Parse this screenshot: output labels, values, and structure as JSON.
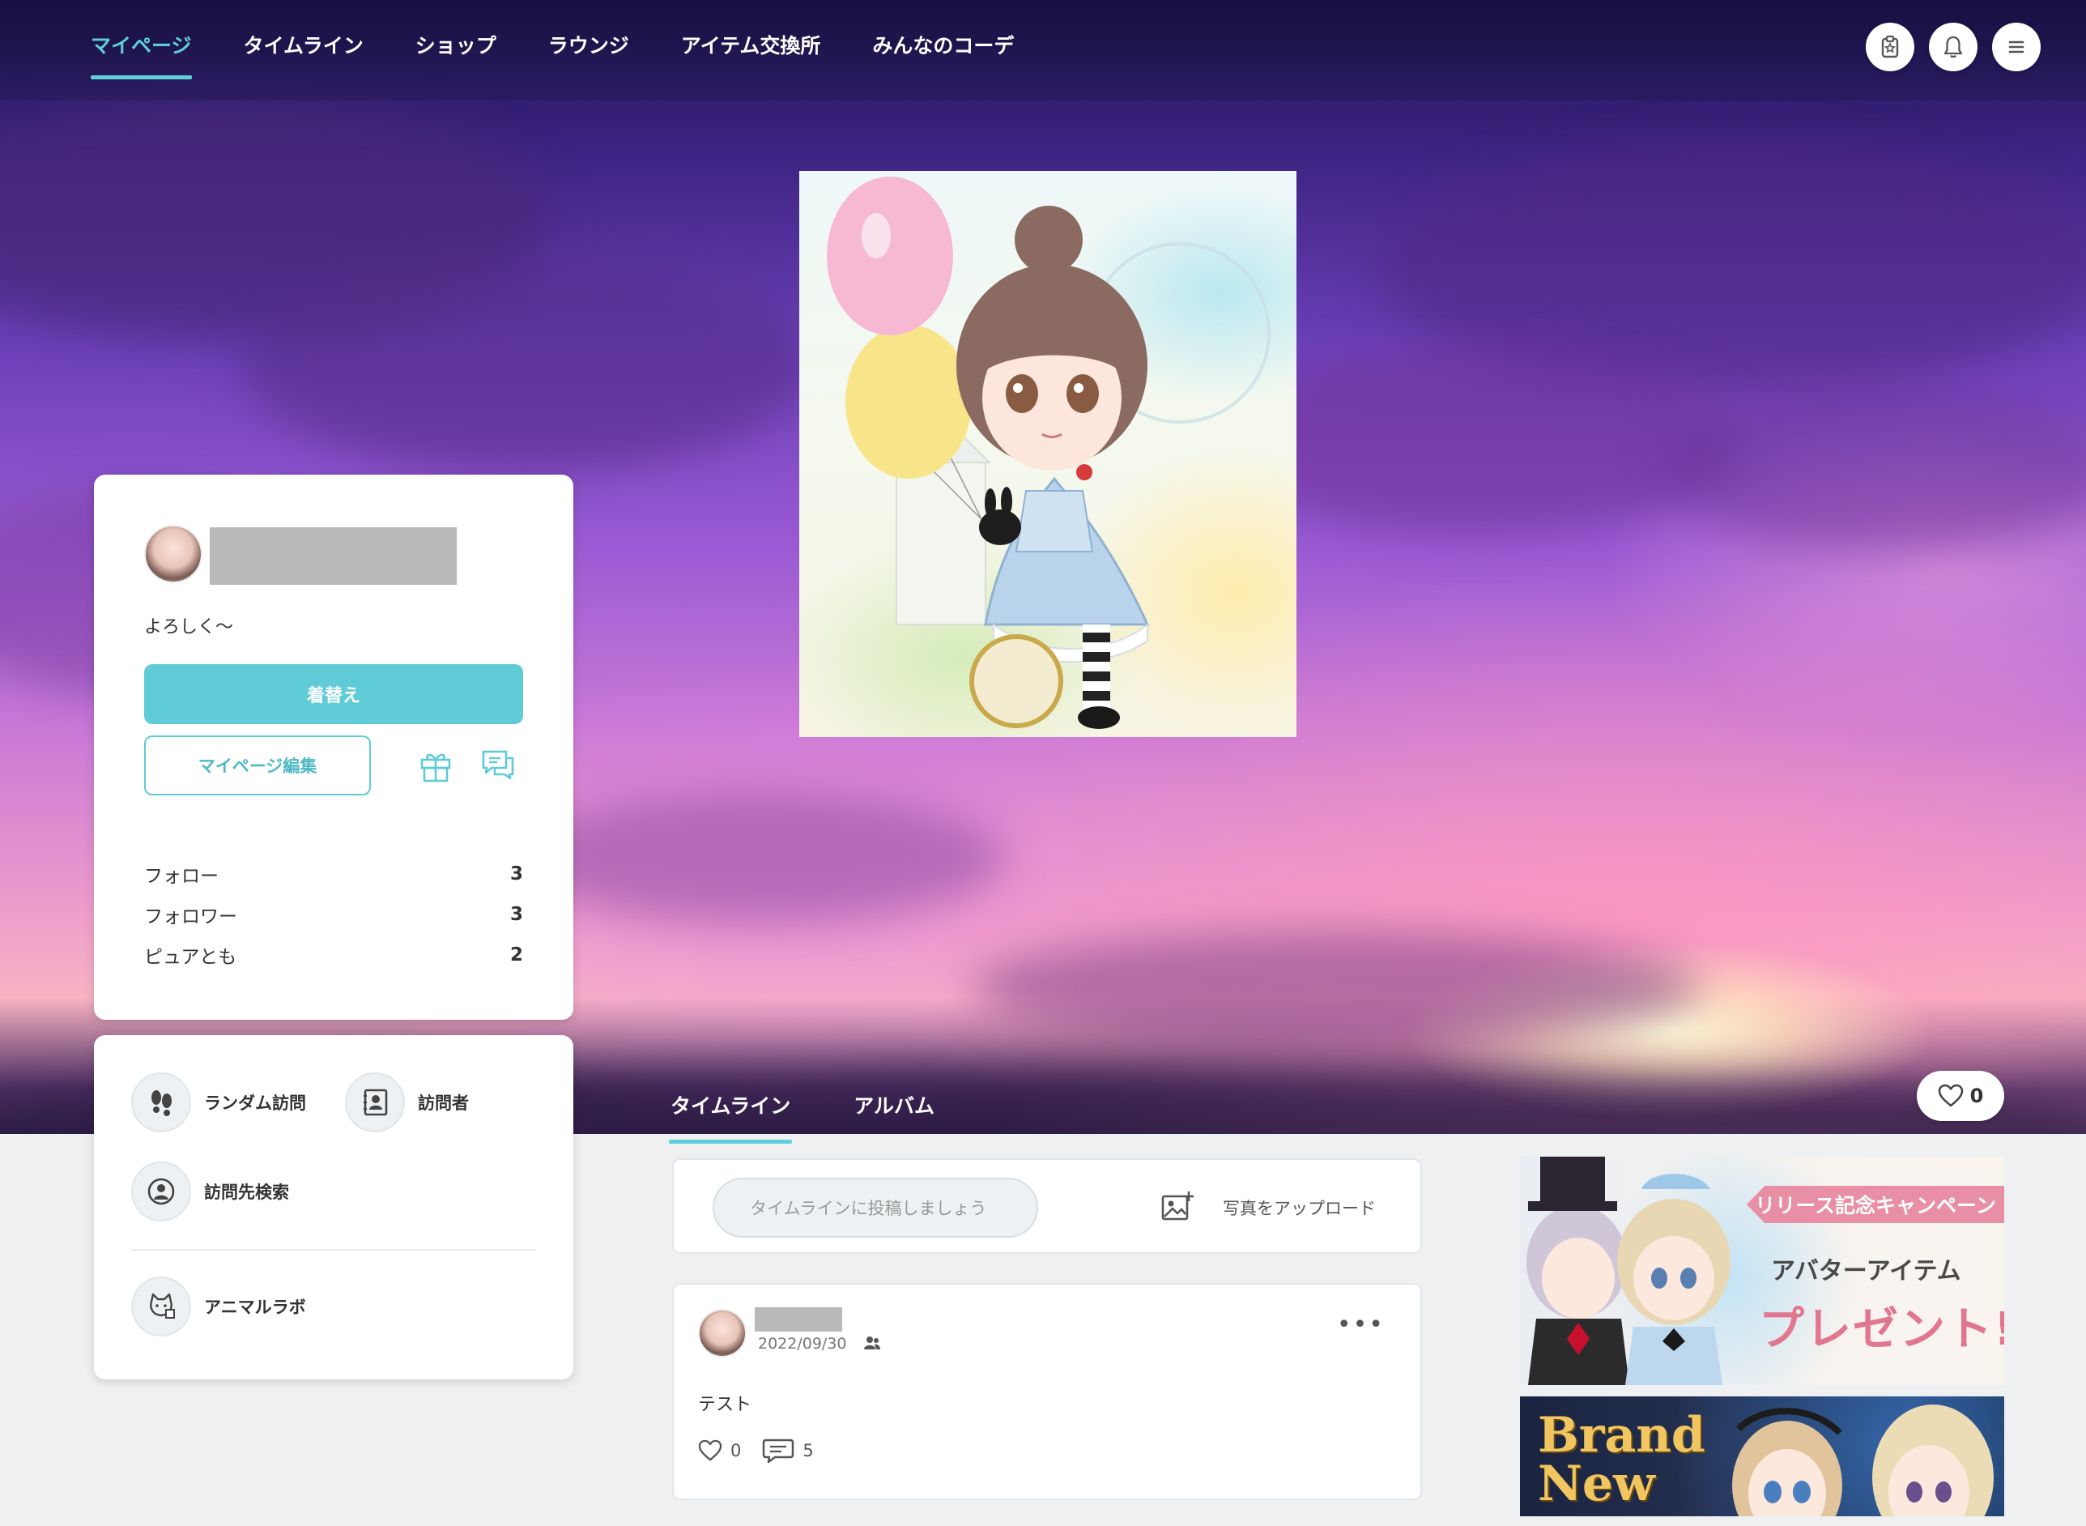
{
  "nav": {
    "tabs": [
      {
        "label": "マイページ",
        "active": true
      },
      {
        "label": "タイムライン",
        "active": false
      },
      {
        "label": "ショップ",
        "active": false
      },
      {
        "label": "ラウンジ",
        "active": false
      },
      {
        "label": "アイテム交換所",
        "active": false
      },
      {
        "label": "みんなのコーデ",
        "active": false
      }
    ],
    "icons": [
      "clipboard-icon",
      "bell-icon",
      "menu-icon"
    ]
  },
  "profile": {
    "bio": "よろしく～",
    "dress_up_label": "着替え",
    "edit_mypage_label": "マイページ編集",
    "stats": [
      {
        "label": "フォロー",
        "value": "3"
      },
      {
        "label": "フォロワー",
        "value": "3"
      },
      {
        "label": "ピュアとも",
        "value": "2"
      }
    ]
  },
  "links": {
    "random_visit": "ランダム訪問",
    "visitors": "訪問者",
    "search_visit": "訪問先検索",
    "animal_lab": "アニマルラボ"
  },
  "likes": {
    "count": "0"
  },
  "timeline": {
    "tabs": [
      {
        "label": "タイムライン",
        "active": true
      },
      {
        "label": "アルバム",
        "active": false
      }
    ],
    "composer_placeholder": "タイムラインに投稿しましょう",
    "upload_label": "写真をアップロード",
    "post": {
      "date": "2022/09/30",
      "body": "テスト",
      "likes": "0",
      "comments": "5"
    }
  },
  "banners": {
    "campaign_tag": "リリース記念キャンペーン",
    "campaign_sub": "アバターアイテム",
    "campaign_main": "プレゼント!",
    "brand_new_line1": "Brand",
    "brand_new_line2": "New"
  },
  "colors": {
    "accent": "#5fcbd6",
    "campaign_pink": "#e2768f",
    "brand_gold": "#f1c660"
  }
}
